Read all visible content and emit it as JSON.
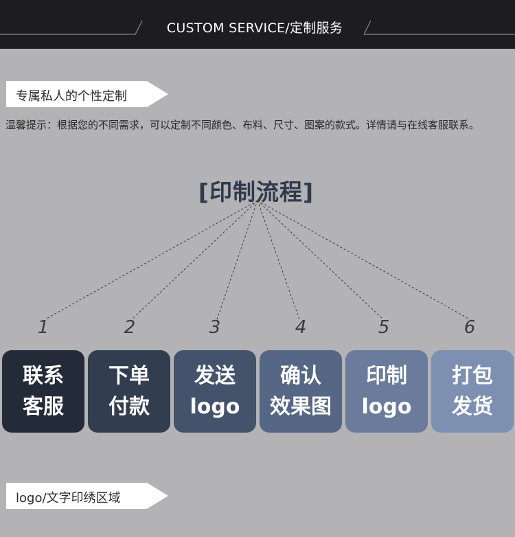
{
  "header": {
    "title": "CUSTOM SERVICE/定制服务"
  },
  "section_exclusive": {
    "label": "专属私人的个性定制"
  },
  "notice": {
    "text": "温馨提示：根据您的不同需求，可以定制不同颜色、布料、尺寸、图案的款式。详情请与在线客服联系。"
  },
  "process": {
    "title": "[印制流程]",
    "steps": [
      {
        "number": "1",
        "label": "联系\n客服",
        "color": "#232a38"
      },
      {
        "number": "2",
        "label": "下单\n付款",
        "color": "#323d50"
      },
      {
        "number": "3",
        "label": "发送\nlogo",
        "color": "#45526b"
      },
      {
        "number": "4",
        "label": "确认\n效果图",
        "color": "#566785"
      },
      {
        "number": "5",
        "label": "印制\nlogo",
        "color": "#6a7b9b"
      },
      {
        "number": "6",
        "label": "打包\n发货",
        "color": "#7d90b2"
      }
    ]
  },
  "section_logo": {
    "label": "logo/文字印绣区域"
  }
}
